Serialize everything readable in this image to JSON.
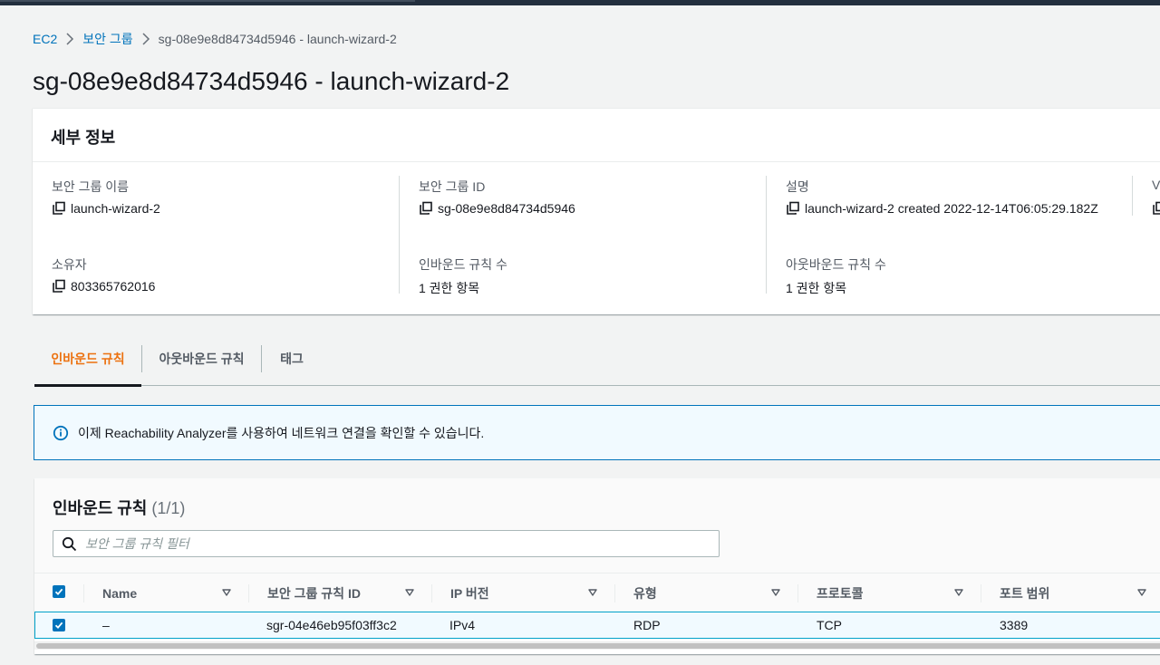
{
  "breadcrumb": {
    "items": [
      "EC2",
      "보안 그룹",
      "sg-08e9e8d84734d5946 - launch-wizard-2"
    ]
  },
  "page": {
    "title": "sg-08e9e8d84734d5946 - launch-wizard-2"
  },
  "details": {
    "title": "세부 정보",
    "fields": [
      {
        "label": "보안 그룹 이름",
        "value": "launch-wizard-2"
      },
      {
        "label": "보안 그룹 ID",
        "value": "sg-08e9e8d84734d5946"
      },
      {
        "label": "설명",
        "value": "launch-wizard-2 created 2022-12-14T06:05:29.182Z"
      },
      {
        "label": "V",
        "value": ""
      },
      {
        "label": "소유자",
        "value": "803365762016"
      },
      {
        "label": "인바운드 규칙 수",
        "value": "1 권한 항목"
      },
      {
        "label": "아웃바운드 규칙 수",
        "value": "1 권한 항목"
      }
    ]
  },
  "tabs": [
    "인바운드 규칙",
    "아웃바운드 규칙",
    "태그"
  ],
  "active_tab": 0,
  "info": {
    "text": "이제 Reachability Analyzer를 사용하여 네트워크 연결을 확인할 수 있습니다."
  },
  "rules": {
    "title": "인바운드 규칙",
    "count": "(1/1)",
    "search_placeholder": "보안 그룹 규칙 필터",
    "columns": [
      "Name",
      "보안 그룹 규칙 ID",
      "IP 버전",
      "유형",
      "프로토콜",
      "포트 범위"
    ],
    "rows": [
      {
        "selected": true,
        "cells": [
          "–",
          "sgr-04e46eb95f03ff3c2",
          "IPv4",
          "RDP",
          "TCP",
          "3389"
        ]
      }
    ]
  },
  "colors": {
    "link": "#0073bb",
    "active_tab": "#ec7211",
    "checkbox": "#0073bb",
    "info_bg": "#f1faff"
  }
}
